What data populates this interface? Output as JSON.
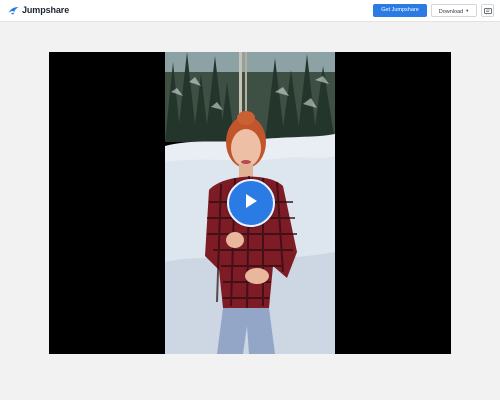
{
  "header": {
    "brand": "Jumpshare",
    "get_button_label": "Get Jumpshare",
    "download_label": "Download",
    "icons": {
      "logo": "jumpshare-logo-icon",
      "download_caret": "chevron-down-icon",
      "comment": "comment-icon",
      "play": "play-icon"
    }
  },
  "colors": {
    "accent": "#2a7be4",
    "page_background": "#f2f2f3",
    "player_background": "#000000"
  }
}
